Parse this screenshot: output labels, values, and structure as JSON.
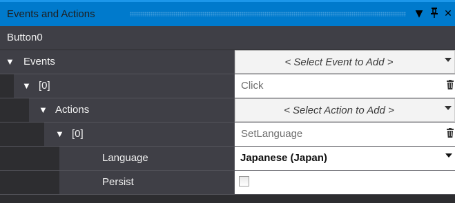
{
  "window": {
    "title": "Events and Actions",
    "dropdown_glyph": "▼",
    "pin_glyph": "📌",
    "close_glyph": "✕"
  },
  "object_name": "Button0",
  "rows": [
    {
      "label": "Events",
      "arrow": "▼",
      "value_kind": "combo",
      "value": "< Select Event to Add >"
    },
    {
      "label": "[0]",
      "arrow": "▼",
      "value_kind": "text-delete",
      "value": "Click"
    },
    {
      "label": "Actions",
      "arrow": "▼",
      "value_kind": "combo",
      "value": "< Select Action to Add >"
    },
    {
      "label": "[0]",
      "arrow": "▼",
      "value_kind": "text-delete",
      "value": "SetLanguage"
    },
    {
      "label": "Language",
      "arrow": "",
      "value_kind": "dropdown",
      "value": "Japanese (Japan)"
    },
    {
      "label": "Persist",
      "arrow": "",
      "value_kind": "checkbox",
      "checked": false
    }
  ],
  "icons": {
    "row_delete": "trash-icon",
    "expand": "expand-arrow-icon"
  }
}
